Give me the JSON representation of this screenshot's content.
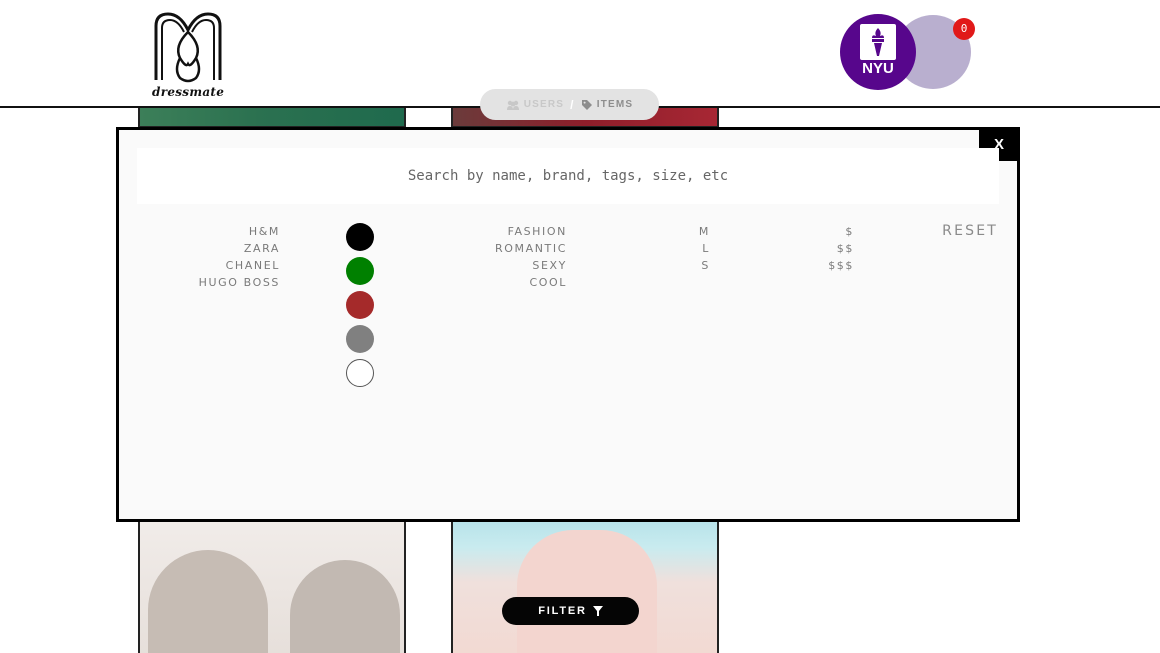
{
  "header": {
    "logo_text": "dressmate",
    "avatar_label": "NYU",
    "cart_count": "0"
  },
  "breadcrumb": {
    "users_label": "USERS",
    "separator": "/",
    "items_label": "ITEMS"
  },
  "modal": {
    "close_label": "X",
    "search_placeholder": "Search by name, brand, tags, size, etc",
    "search_value": "",
    "brands": [
      "H&M",
      "ZARA",
      "CHANEL",
      "HUGO BOSS"
    ],
    "colors": [
      "#000000",
      "#008000",
      "#a52a2a",
      "#808080",
      "#ffffff"
    ],
    "tags": [
      "FASHION",
      "ROMANTIC",
      "SEXY",
      "COOL"
    ],
    "sizes": [
      "M",
      "L",
      "S"
    ],
    "prices": [
      "$",
      "$$",
      "$$$"
    ],
    "reset_label": "RESET"
  },
  "filter_button": {
    "label": "FILTER"
  },
  "colors": {
    "avatar_purple": "#57068c",
    "avatar_back": "#b9afcf",
    "badge_red": "#e11919"
  }
}
